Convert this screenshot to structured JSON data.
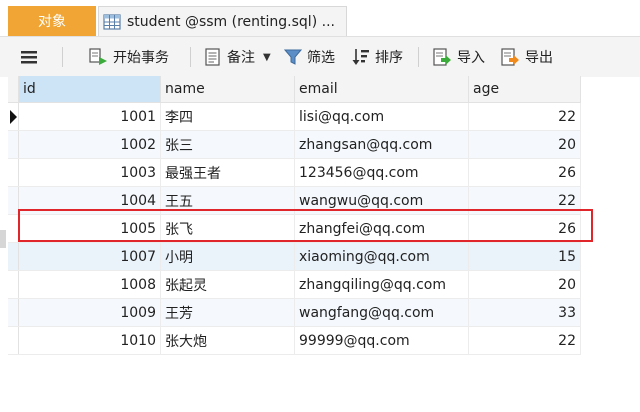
{
  "tabs": {
    "objects_label": "对象",
    "active_label": "student @ssm (renting.sql) ..."
  },
  "toolbar": {
    "begin_transaction": "开始事务",
    "note": "备注",
    "filter": "筛选",
    "sort": "排序",
    "import": "导入",
    "export": "导出"
  },
  "table": {
    "columns": [
      "id",
      "name",
      "email",
      "age"
    ],
    "rows": [
      {
        "id": "1001",
        "name": "李四",
        "email": "lisi@qq.com",
        "age": "22"
      },
      {
        "id": "1002",
        "name": "张三",
        "email": "zhangsan@qq.com",
        "age": "20"
      },
      {
        "id": "1003",
        "name": "最强王者",
        "email": "123456@qq.com",
        "age": "26"
      },
      {
        "id": "1004",
        "name": "王五",
        "email": "wangwu@qq.com",
        "age": "22"
      },
      {
        "id": "1005",
        "name": "张飞",
        "email": "zhangfei@qq.com",
        "age": "26"
      },
      {
        "id": "1007",
        "name": "小明",
        "email": "xiaoming@qq.com",
        "age": "15"
      },
      {
        "id": "1008",
        "name": "张起灵",
        "email": "zhangqiling@qq.com",
        "age": "20"
      },
      {
        "id": "1009",
        "name": "王芳",
        "email": "wangfang@qq.com",
        "age": "33"
      },
      {
        "id": "1010",
        "name": "张大炮",
        "email": "99999@qq.com",
        "age": "22"
      }
    ]
  },
  "colors": {
    "objects_tab": "#f0a534",
    "highlight_box": "#e0262b",
    "selected_header": "#cde4f7"
  }
}
